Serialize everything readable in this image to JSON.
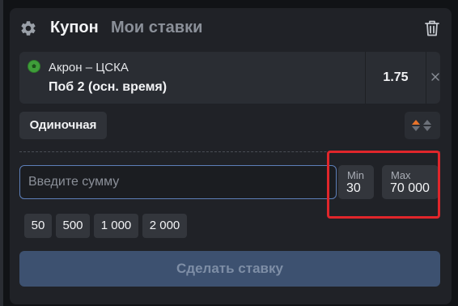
{
  "header": {
    "coupon_tab": "Купон",
    "bets_tab": "Мои ставки",
    "settings_icon": "gear-icon",
    "delete_icon": "trash-icon"
  },
  "event": {
    "sport_icon": "soccer-ball-icon",
    "match": "Акрон – ЦСКА",
    "outcome": "Поб 2 (осн. время)",
    "odds": "1.75",
    "remove_icon": "close-icon"
  },
  "bet_type": {
    "label": "Одиночная",
    "sort_icon": "sort-arrows-icon"
  },
  "stake": {
    "placeholder": "Введите сумму",
    "value": ""
  },
  "limits": {
    "min_label": "Min",
    "min_value": "30",
    "max_label": "Max",
    "max_value": "70 000"
  },
  "quick_amounts": [
    "50",
    "500",
    "1 000",
    "2 000"
  ],
  "place_bet_label": "Сделать ставку",
  "colors": {
    "background": "#111316",
    "panel": "#202227",
    "card": "#2a2d33",
    "input_border": "#5d7fb8",
    "place_bet_disabled": "#3d5170",
    "highlight_box": "#e0262b",
    "sort_up_arrow": "#e8732a"
  }
}
